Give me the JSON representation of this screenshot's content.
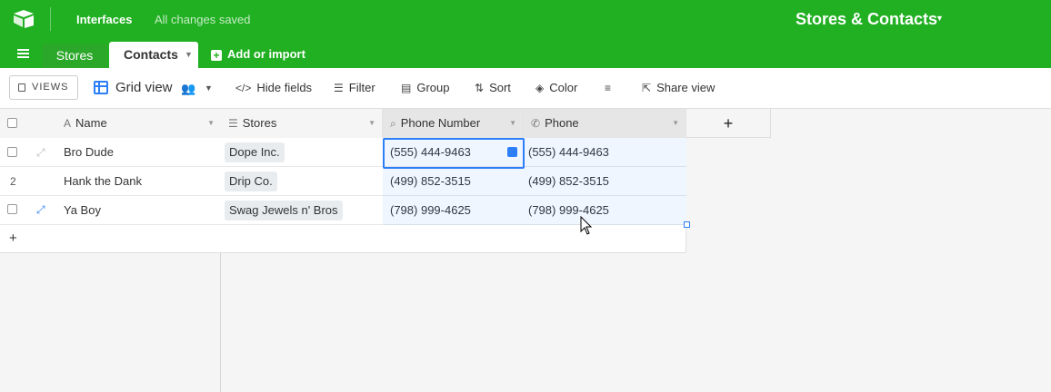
{
  "app": {
    "interfaces_label": "Interfaces",
    "save_status": "All changes saved",
    "base_title": "Stores & Contacts",
    "brand_color": "#20b021"
  },
  "tabs": {
    "items": [
      {
        "label": "Stores",
        "active": false
      },
      {
        "label": "Contacts",
        "active": true
      }
    ],
    "add_import_label": "Add or import"
  },
  "toolbar": {
    "views_label": "VIEWS",
    "view_name": "Grid view",
    "hide_fields": "Hide fields",
    "filter": "Filter",
    "group": "Group",
    "sort": "Sort",
    "color": "Color",
    "share_view": "Share view"
  },
  "grid": {
    "columns": [
      {
        "label": "Name",
        "icon": "text-icon"
      },
      {
        "label": "Stores",
        "icon": "link-icon"
      },
      {
        "label": "Phone Number",
        "icon": "lookup-icon"
      },
      {
        "label": "Phone",
        "icon": "phone-icon"
      }
    ],
    "rows": [
      {
        "num": "",
        "name": "Bro Dude",
        "store": "Dope Inc.",
        "phone_number": "(555) 444-9463",
        "phone": "(555) 444-9463"
      },
      {
        "num": "2",
        "name": "Hank the Dank",
        "store": "Drip Co.",
        "phone_number": "(499) 852-3515",
        "phone": "(499) 852-3515"
      },
      {
        "num": "",
        "name": "Ya Boy",
        "store": "Swag Jewels n' Bros",
        "phone_number": "(798) 999-4625",
        "phone": "(798) 999-4625"
      }
    ],
    "add_row": "+",
    "add_field": "+"
  }
}
